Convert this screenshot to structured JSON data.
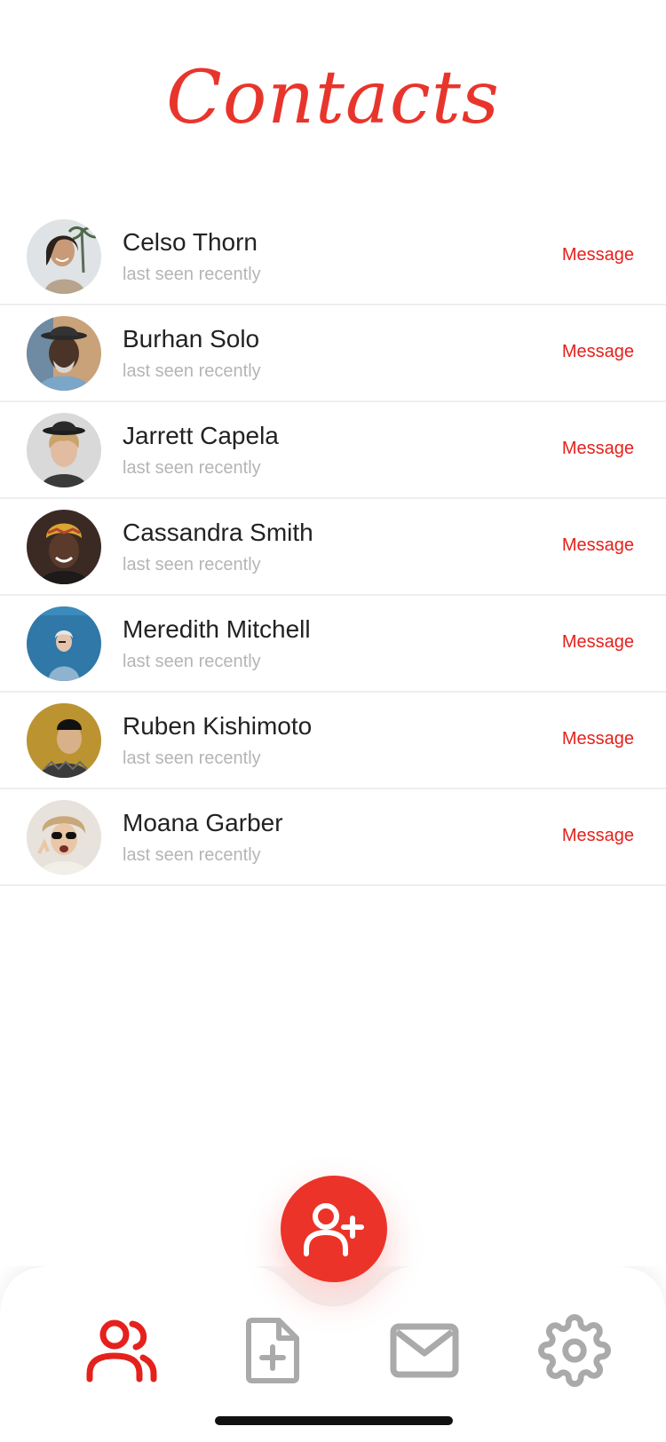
{
  "page": {
    "title": "Contacts"
  },
  "contacts": [
    {
      "name": "Celso Thorn",
      "status": "last seen recently",
      "action": "Message",
      "avatar": "woman-smiling-palms-photo"
    },
    {
      "name": "Burhan Solo",
      "status": "last seen recently",
      "action": "Message",
      "avatar": "man-hat-beard-photo"
    },
    {
      "name": "Jarrett Capela",
      "status": "last seen recently",
      "action": "Message",
      "avatar": "young-man-hat-photo"
    },
    {
      "name": "Cassandra Smith",
      "status": "last seen recently",
      "action": "Message",
      "avatar": "woman-headwrap-photo"
    },
    {
      "name": "Meredith Mitchell",
      "status": "last seen recently",
      "action": "Message",
      "avatar": "person-blue-wall-photo"
    },
    {
      "name": "Ruben Kishimoto",
      "status": "last seen recently",
      "action": "Message",
      "avatar": "man-beanie-yellow-photo"
    },
    {
      "name": "Moana Garber",
      "status": "last seen recently",
      "action": "Message",
      "avatar": "woman-sunglasses-photo"
    }
  ],
  "fab": {
    "icon": "add-user-icon"
  },
  "tabbar": {
    "tabs": [
      {
        "icon": "users-icon",
        "active": true
      },
      {
        "icon": "file-plus-icon",
        "active": false
      },
      {
        "icon": "mail-icon",
        "active": false
      },
      {
        "icon": "gear-icon",
        "active": false
      }
    ]
  },
  "colors": {
    "accent": "#e8352c",
    "link": "#e4211c",
    "inactive_icon": "#aaaaaa",
    "name_text": "#222222",
    "status_text": "#b5b5b5",
    "divider": "#eeeeee"
  }
}
